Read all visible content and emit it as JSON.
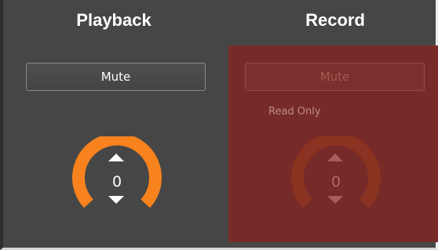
{
  "playback": {
    "title": "Playback",
    "mute_label": "Mute",
    "volume_value": "0",
    "accent_color": "#f7821e"
  },
  "record": {
    "title": "Record",
    "mute_label": "Mute",
    "status_text": "Read Only",
    "volume_value": "0",
    "accent_color": "#8c3220",
    "background_color": "#772b29"
  },
  "icons": {
    "increase": "triangle-up-icon",
    "decrease": "triangle-down-icon"
  }
}
